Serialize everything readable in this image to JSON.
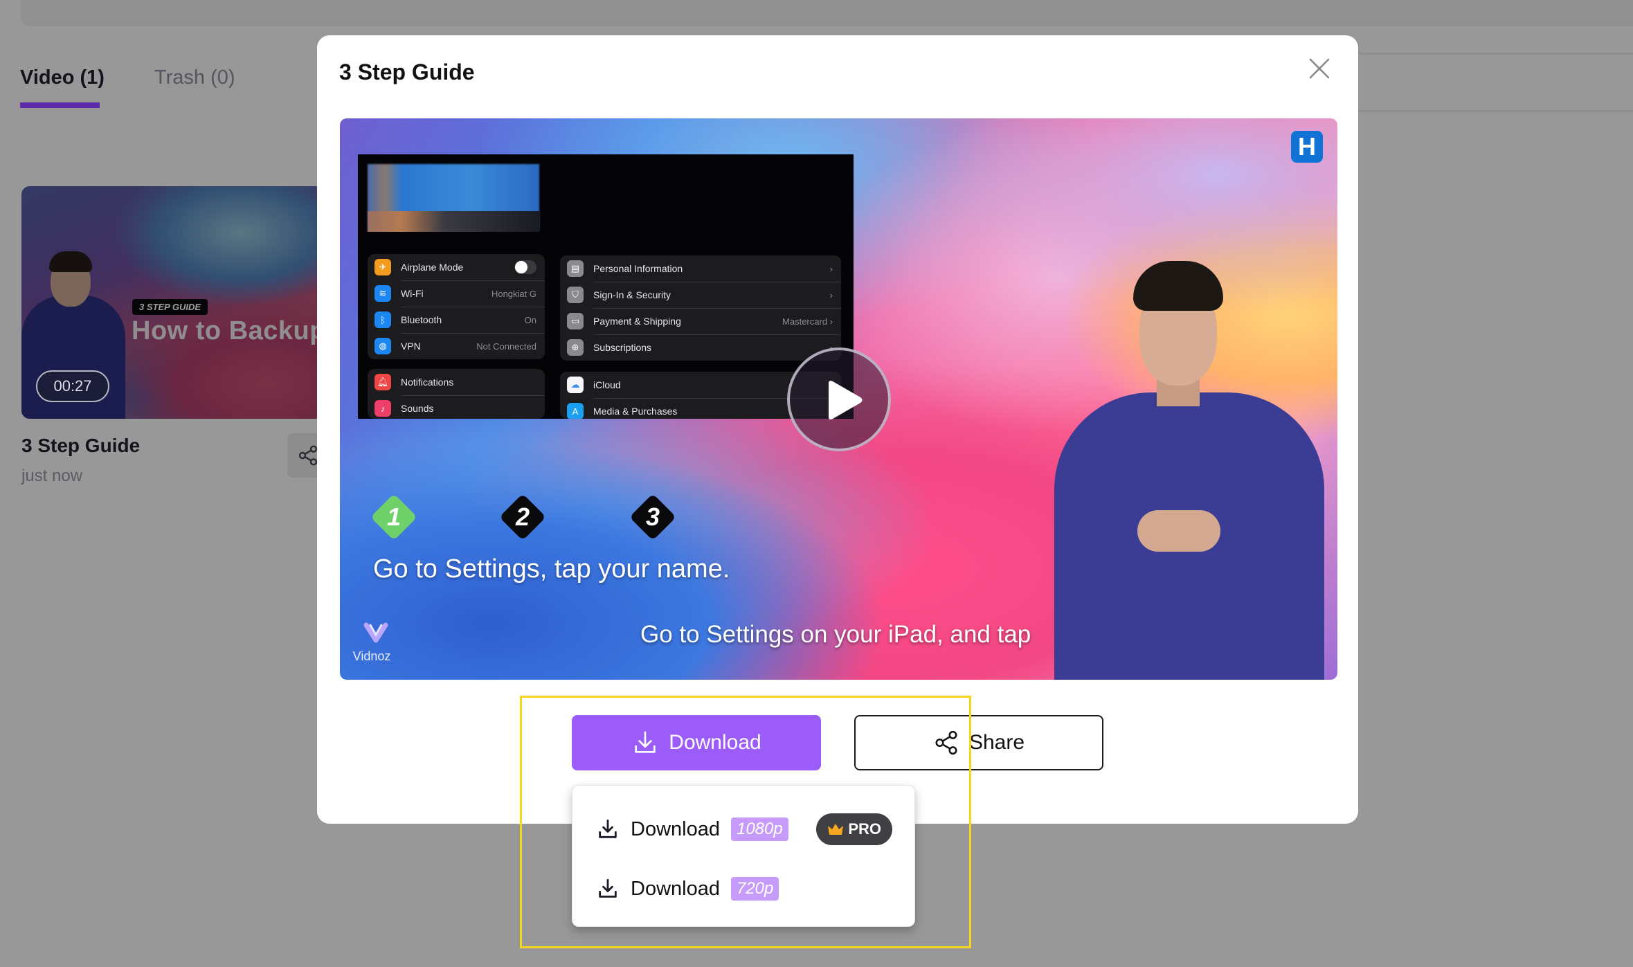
{
  "background": {
    "tabs": [
      {
        "label": "Video (1)",
        "active": true
      },
      {
        "label": "Trash (0)",
        "active": false
      }
    ],
    "card": {
      "thumbnail_tag": "3 STEP GUIDE",
      "thumbnail_headline": "How to Backup",
      "duration": "00:27",
      "title": "3 Step Guide",
      "time": "just now"
    }
  },
  "modal": {
    "title": "3 Step Guide",
    "close_icon": "close-icon",
    "video": {
      "brand_badge": "H",
      "settings_left": [
        {
          "icon": "airplane-icon",
          "label": "Airplane Mode",
          "value": "",
          "toggle": true,
          "color": "#f29b1d"
        },
        {
          "icon": "wifi-icon",
          "label": "Wi-Fi",
          "value": "Hongkiat G",
          "color": "#1c86f2"
        },
        {
          "icon": "bluetooth-icon",
          "label": "Bluetooth",
          "value": "On",
          "color": "#1c86f2"
        },
        {
          "icon": "vpn-icon",
          "label": "VPN",
          "value": "Not Connected",
          "color": "#1c86f2"
        }
      ],
      "settings_left2": [
        {
          "icon": "notifications-icon",
          "label": "Notifications",
          "color": "#ee4646"
        },
        {
          "icon": "sounds-icon",
          "label": "Sounds",
          "color": "#ee3f6a"
        }
      ],
      "settings_right": [
        {
          "icon": "id-card-icon",
          "label": "Personal Information",
          "value": "›"
        },
        {
          "icon": "shield-icon",
          "label": "Sign-In & Security",
          "value": "›"
        },
        {
          "icon": "card-icon",
          "label": "Payment & Shipping",
          "value": "Mastercard ›"
        },
        {
          "icon": "subscriptions-icon",
          "label": "Subscriptions",
          "value": "›"
        }
      ],
      "settings_right2": [
        {
          "icon": "icloud-icon",
          "label": "iCloud"
        },
        {
          "icon": "app-store-icon",
          "label": "Media & Purchases"
        }
      ],
      "steps": [
        "1",
        "2",
        "3"
      ],
      "active_step": 1,
      "step_text": "Go to Settings, tap your name.",
      "caption": "Go to Settings on your iPad, and tap",
      "watermark": "Vidnoz"
    },
    "actions": {
      "download_label": "Download",
      "share_label": "Share"
    }
  },
  "download_menu": {
    "items": [
      {
        "label": "Download",
        "resolution": "1080p",
        "badge": "PRO"
      },
      {
        "label": "Download",
        "resolution": "720p"
      }
    ]
  },
  "colors": {
    "accent": "#9b5cfa",
    "resolution_badge": "#c79bfa",
    "tab_underline": "#5a2aa8",
    "highlight": "#f4d61c",
    "pro_crown": "#f5a623"
  }
}
